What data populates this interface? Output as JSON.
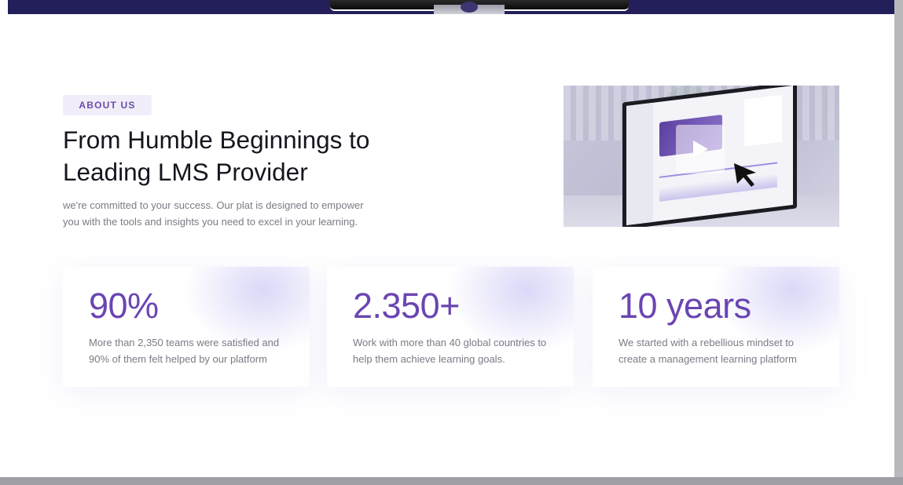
{
  "about": {
    "badge": "ABOUT US",
    "title_line1": "From Humble Beginnings to",
    "title_line2": "Leading LMS Provider",
    "description_line1": "we're committed to your success. Our plat is designed to empower",
    "description_line2": "you with the tools and insights you need to excel in your learning."
  },
  "video": {
    "play_icon": "play-icon",
    "cursor_icon": "cursor-icon"
  },
  "stats": [
    {
      "value": "90%",
      "line1": "More than 2,350 teams were satisfied and",
      "line2": "90% of them felt helped by our platform"
    },
    {
      "value": "2.350+",
      "line1": "Work with more than 40 global countries to",
      "line2": "help them achieve learning goals."
    },
    {
      "value": "10 years",
      "line1": "We started with a rebellious mindset to",
      "line2": "create a management learning platform"
    }
  ],
  "colors": {
    "accent": "#6a45b2",
    "header_band": "#221f5a",
    "badge_bg": "#f1edf9"
  }
}
